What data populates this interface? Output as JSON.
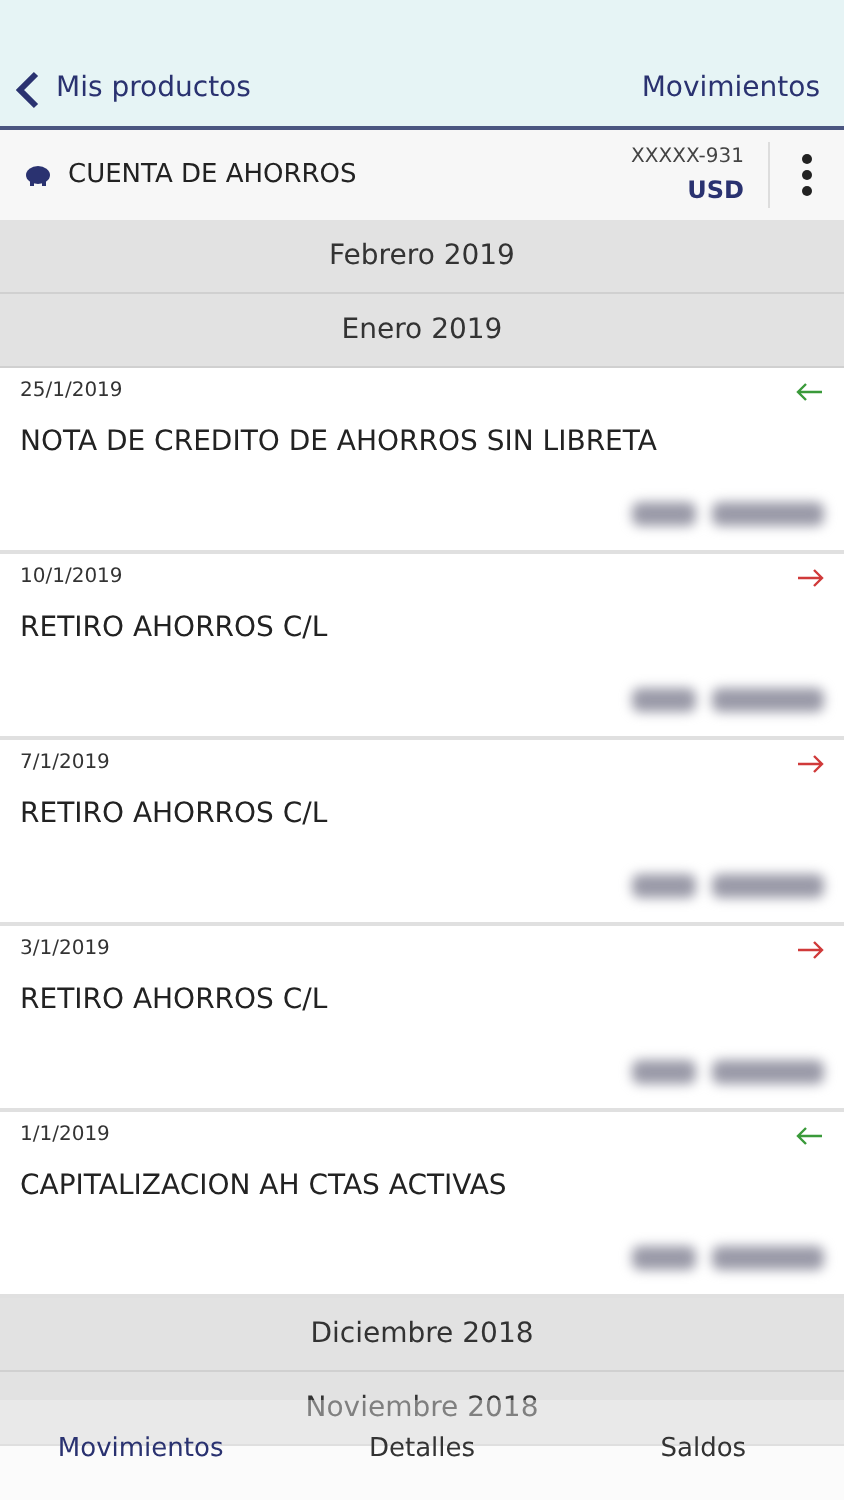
{
  "nav": {
    "back_label": "Mis productos",
    "title": "Movimientos"
  },
  "account": {
    "name": "CUENTA DE AHORROS",
    "number": "XXXXX-931",
    "currency": "USD"
  },
  "sections": [
    {
      "month": "Febrero 2019"
    },
    {
      "month": "Enero 2019",
      "transactions": [
        {
          "date": "25/1/2019",
          "description": "NOTA DE CREDITO DE AHORROS SIN LIBRETA",
          "kind": "in"
        },
        {
          "date": "10/1/2019",
          "description": "RETIRO AHORROS C/L",
          "kind": "out"
        },
        {
          "date": "7/1/2019",
          "description": "RETIRO AHORROS C/L",
          "kind": "out"
        },
        {
          "date": "3/1/2019",
          "description": "RETIRO AHORROS C/L",
          "kind": "out"
        },
        {
          "date": "1/1/2019",
          "description": "CAPITALIZACION AH CTAS ACTIVAS",
          "kind": "in"
        }
      ]
    },
    {
      "month": "Diciembre 2018"
    },
    {
      "month": "Noviembre 2018"
    }
  ],
  "tabs": [
    {
      "label": "Movimientos",
      "selected": true
    },
    {
      "label": "Detalles",
      "selected": false
    },
    {
      "label": "Saldos",
      "selected": false
    }
  ]
}
